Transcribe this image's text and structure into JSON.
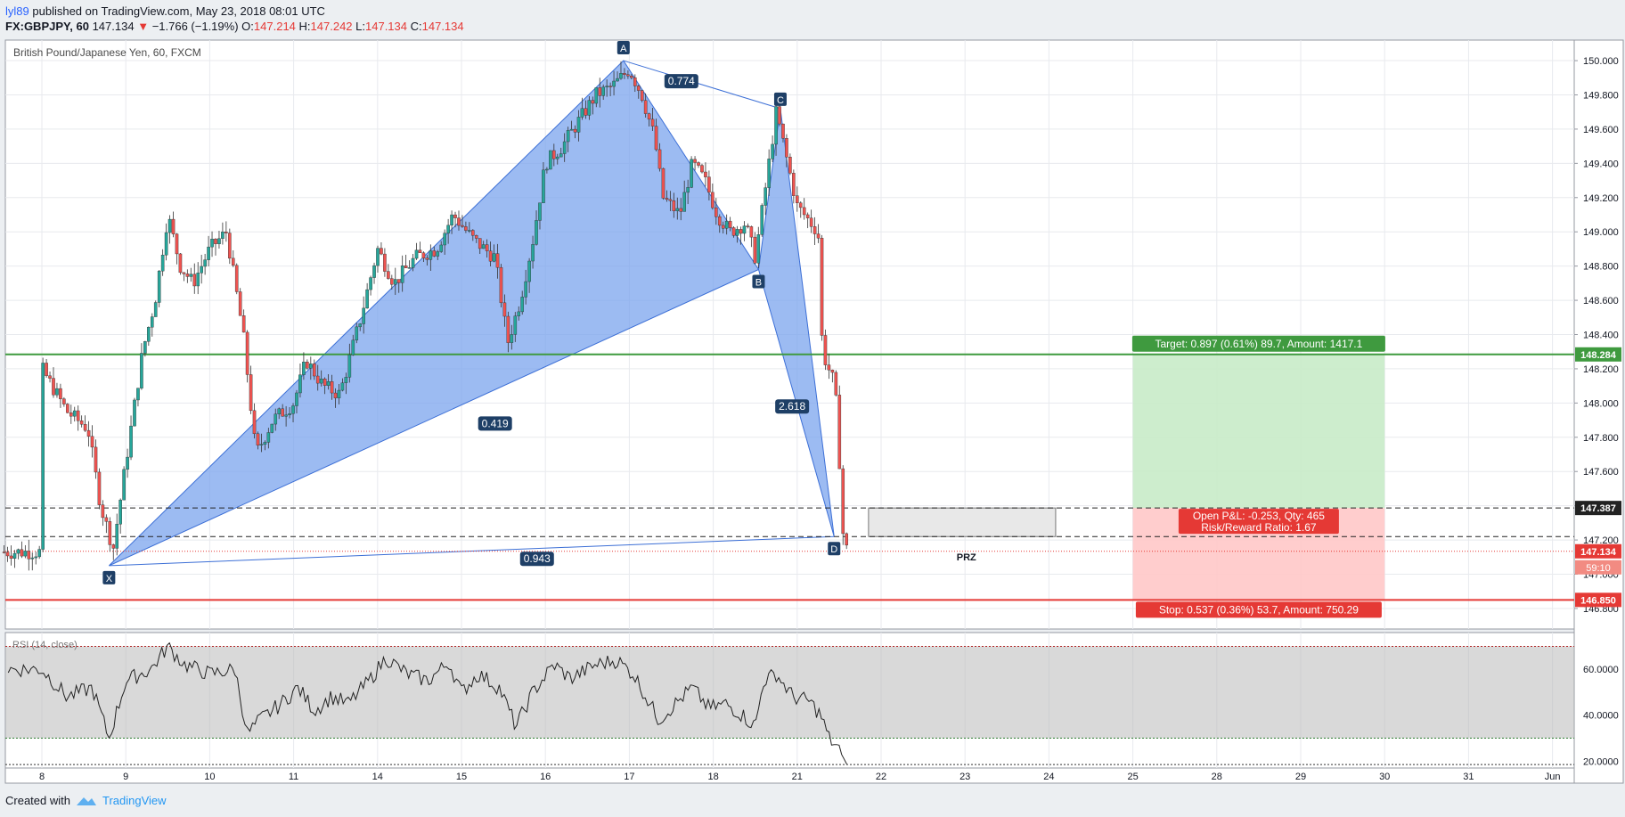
{
  "header": {
    "author": "lyl89",
    "published_text": "published on TradingView.com, May 23, 2018 08:01 UTC",
    "symbol": "FX:GBPJPY, 60",
    "last_price": "147.134",
    "change_arrow": "▼",
    "change": "−1.766 (−1.19%)",
    "open_label": "O:",
    "open": "147.214",
    "high_label": "H:",
    "high": "147.242",
    "low_label": "L:",
    "low": "147.134",
    "close_label": "C:",
    "close": "147.134"
  },
  "footer": {
    "created_with": "Created with",
    "brand": "TradingView"
  },
  "colors": {
    "bull": "#26a69a",
    "bear": "#ef5350",
    "harmonic_fill": "#7ba4ee",
    "harmonic_line": "#3c6fd6",
    "target_zone": "#c8ebc8",
    "stop_zone": "#ffc8c8",
    "target_line": "#3f9a3f",
    "stop_line": "#e53935"
  },
  "chart_data": {
    "type": "candlestick",
    "title": "British Pound/Japanese Yen, 60, FXCM",
    "x_tick_labels": [
      "8",
      "9",
      "10",
      "11",
      "14",
      "15",
      "16",
      "17",
      "18",
      "21",
      "22",
      "23",
      "24",
      "25",
      "28",
      "29",
      "30",
      "31",
      "Jun"
    ],
    "y_ticks": [
      "146.800",
      "147.000",
      "147.200",
      "147.400",
      "147.600",
      "147.800",
      "148.000",
      "148.200",
      "148.400",
      "148.600",
      "148.800",
      "149.000",
      "149.200",
      "149.400",
      "149.600",
      "149.800",
      "150.000"
    ],
    "y_tick_values": [
      146.8,
      147.0,
      147.2,
      147.4,
      147.6,
      147.8,
      148.0,
      148.2,
      148.4,
      148.6,
      148.8,
      149.0,
      149.2,
      149.4,
      149.6,
      149.8,
      150.0
    ],
    "ylim": [
      146.68,
      150.12
    ],
    "price_path": [
      [
        0.0,
        148.2
      ],
      [
        0.3,
        147.95
      ],
      [
        0.55,
        147.85
      ],
      [
        0.7,
        147.4
      ],
      [
        0.85,
        147.15
      ],
      [
        1.0,
        147.65
      ],
      [
        1.2,
        148.3
      ],
      [
        1.35,
        148.6
      ],
      [
        1.5,
        149.1
      ],
      [
        1.65,
        148.8
      ],
      [
        1.8,
        148.7
      ],
      [
        2.0,
        148.9
      ],
      [
        2.2,
        149.0
      ],
      [
        2.4,
        148.4
      ],
      [
        2.55,
        147.7
      ],
      [
        2.75,
        147.9
      ],
      [
        3.0,
        148.0
      ],
      [
        3.15,
        148.25
      ],
      [
        3.35,
        148.1
      ],
      [
        3.55,
        148.05
      ],
      [
        3.8,
        148.5
      ],
      [
        4.0,
        148.9
      ],
      [
        4.2,
        148.7
      ],
      [
        4.45,
        148.85
      ],
      [
        4.7,
        148.9
      ],
      [
        4.9,
        149.1
      ],
      [
        5.15,
        148.95
      ],
      [
        5.4,
        148.85
      ],
      [
        5.55,
        148.35
      ],
      [
        5.7,
        148.6
      ],
      [
        5.85,
        148.95
      ],
      [
        6.0,
        149.4
      ],
      [
        6.2,
        149.5
      ],
      [
        6.4,
        149.65
      ],
      [
        6.6,
        149.8
      ],
      [
        6.8,
        149.85
      ],
      [
        7.0,
        149.95
      ],
      [
        7.15,
        149.8
      ],
      [
        7.3,
        149.55
      ],
      [
        7.4,
        149.2
      ],
      [
        7.6,
        149.1
      ],
      [
        7.75,
        149.4
      ],
      [
        7.9,
        149.3
      ],
      [
        8.05,
        149.1
      ],
      [
        8.2,
        149.0
      ],
      [
        8.38,
        149.05
      ],
      [
        8.5,
        148.85
      ],
      [
        8.62,
        149.25
      ],
      [
        8.75,
        149.7
      ],
      [
        8.82,
        149.55
      ],
      [
        9.0,
        149.15
      ],
      [
        9.25,
        149.0
      ],
      [
        9.3,
        148.3
      ],
      [
        9.45,
        148.1
      ],
      [
        9.5,
        147.7
      ],
      [
        9.55,
        147.2
      ],
      [
        9.6,
        147.13
      ]
    ],
    "rsi": {
      "label": "RSI (14, close)",
      "overbought": 70,
      "oversold": 30,
      "y_ticks": [
        "20.0000",
        "40.0000",
        "60.0000"
      ],
      "y_tick_values": [
        20,
        40,
        60
      ],
      "ylim": [
        17,
        76
      ],
      "values": [
        [
          0.0,
          60
        ],
        [
          0.3,
          48
        ],
        [
          0.6,
          52
        ],
        [
          0.8,
          30
        ],
        [
          1.0,
          55
        ],
        [
          1.3,
          60
        ],
        [
          1.5,
          70
        ],
        [
          1.7,
          62
        ],
        [
          2.0,
          58
        ],
        [
          2.3,
          60
        ],
        [
          2.45,
          32
        ],
        [
          2.6,
          38
        ],
        [
          2.85,
          45
        ],
        [
          3.05,
          52
        ],
        [
          3.25,
          42
        ],
        [
          3.45,
          48
        ],
        [
          3.65,
          45
        ],
        [
          3.9,
          55
        ],
        [
          4.1,
          65
        ],
        [
          4.35,
          58
        ],
        [
          4.6,
          55
        ],
        [
          4.85,
          63
        ],
        [
          5.0,
          50
        ],
        [
          5.2,
          58
        ],
        [
          5.45,
          52
        ],
        [
          5.65,
          35
        ],
        [
          5.85,
          50
        ],
        [
          6.1,
          62
        ],
        [
          6.3,
          56
        ],
        [
          6.6,
          62
        ],
        [
          6.85,
          64
        ],
        [
          7.05,
          58
        ],
        [
          7.35,
          38
        ],
        [
          7.55,
          45
        ],
        [
          7.75,
          52
        ],
        [
          7.95,
          43
        ],
        [
          8.15,
          45
        ],
        [
          8.35,
          40
        ],
        [
          8.5,
          35
        ],
        [
          8.6,
          55
        ],
        [
          8.75,
          58
        ],
        [
          8.95,
          48
        ],
        [
          9.15,
          46
        ],
        [
          9.28,
          40
        ],
        [
          9.38,
          30
        ],
        [
          9.5,
          25
        ],
        [
          9.6,
          18
        ]
      ]
    },
    "harmonic_pattern": {
      "points": [
        {
          "label": "X",
          "x": 0.8,
          "y": 147.05
        },
        {
          "label": "A",
          "x": 6.93,
          "y": 150.0
        },
        {
          "label": "B",
          "x": 8.54,
          "y": 148.78
        },
        {
          "label": "C",
          "x": 8.8,
          "y": 149.72
        },
        {
          "label": "D",
          "x": 9.44,
          "y": 147.22
        }
      ],
      "ratios": [
        {
          "label": "0.419",
          "x": 5.4,
          "y": 147.88
        },
        {
          "label": "0.774",
          "x": 7.62,
          "y": 149.88
        },
        {
          "label": "2.618",
          "x": 8.94,
          "y": 147.98
        },
        {
          "label": "0.943",
          "x": 5.9,
          "y": 147.09
        }
      ]
    },
    "price_levels": [
      {
        "value": 148.284,
        "label": "148.284",
        "style": "target"
      },
      {
        "value": 147.387,
        "label": "147.387",
        "style": "dashed"
      },
      {
        "value": 147.22,
        "label": "",
        "style": "dashed"
      },
      {
        "value": 147.134,
        "label": "147.134",
        "style": "current"
      },
      {
        "value": 146.85,
        "label": "146.850",
        "style": "stop"
      }
    ],
    "countdown": "59:10",
    "prz": {
      "label": "PRZ",
      "x0": 9.85,
      "x1": 12.08,
      "y0": 147.22,
      "y1": 147.387
    },
    "position": {
      "x0": 13.0,
      "x1": 16.0,
      "entry": 147.387,
      "target": 148.284,
      "stop": 146.85,
      "target_text": "Target: 0.897 (0.61%) 89.7, Amount: 1417.1",
      "stop_text": "Stop: 0.537 (0.36%) 53.7, Amount: 750.29",
      "pnl_text": "Open P&L: -0.253, Qty: 465",
      "rr_text": "Risk/Reward Ratio: 1.67"
    }
  }
}
